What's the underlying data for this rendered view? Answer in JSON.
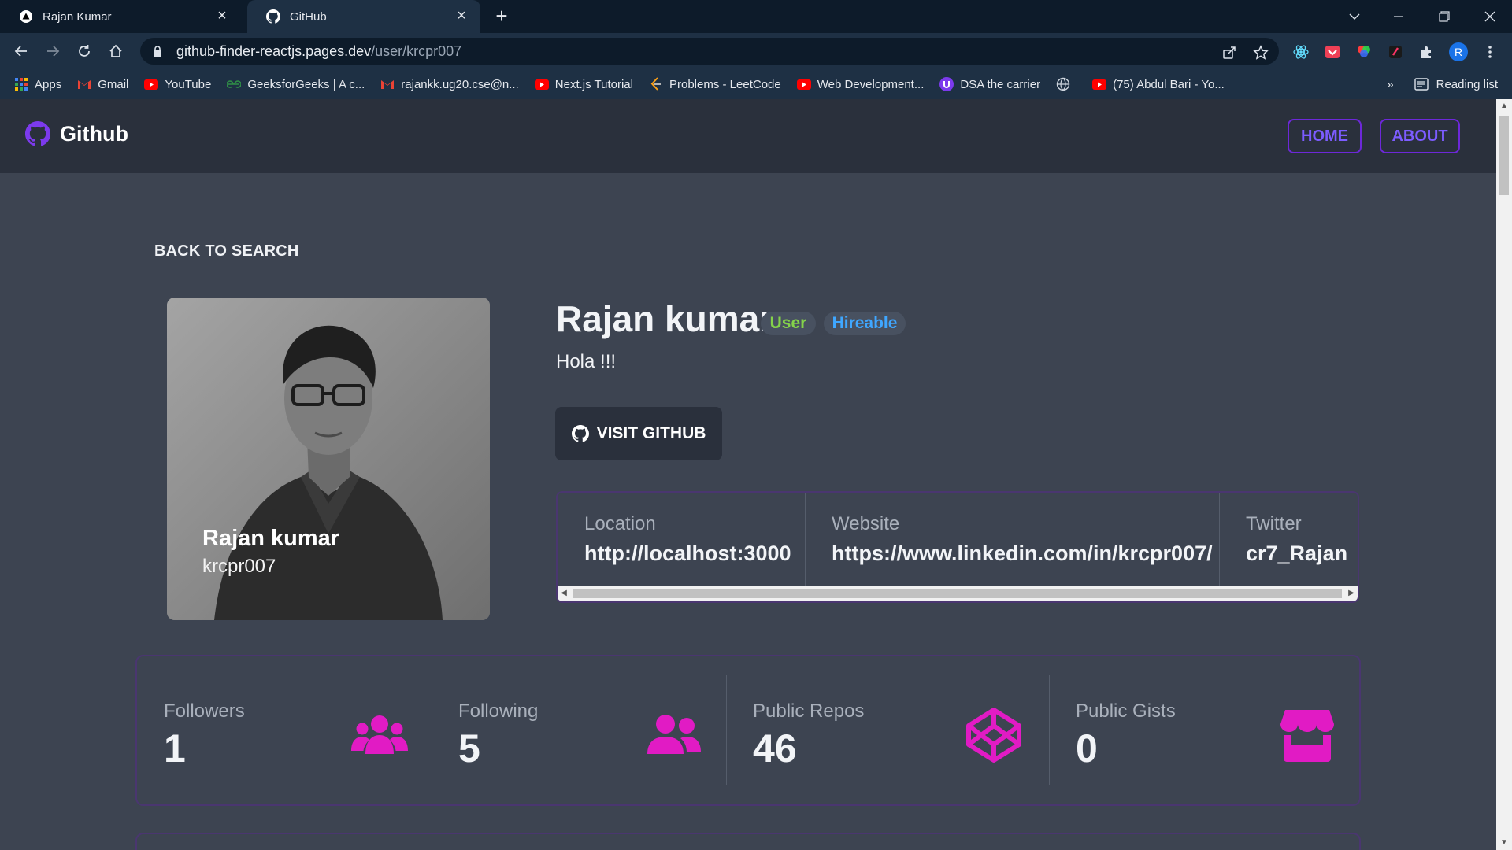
{
  "browser": {
    "tabs": [
      {
        "title": "Rajan Kumar",
        "active": false
      },
      {
        "title": "GitHub",
        "active": true
      }
    ],
    "url_host": "github-finder-reactjs.pages.dev",
    "url_path": "/user/krcpr007",
    "bookmarks": [
      {
        "label": "Apps",
        "icon": "apps-grid-icon"
      },
      {
        "label": "Gmail",
        "icon": "gmail-icon"
      },
      {
        "label": "YouTube",
        "icon": "youtube-icon"
      },
      {
        "label": "GeeksforGeeks | A c...",
        "icon": "gfg-icon"
      },
      {
        "label": "rajankk.ug20.cse@n...",
        "icon": "gmail-icon"
      },
      {
        "label": "Next.js Tutorial",
        "icon": "youtube-icon"
      },
      {
        "label": "Problems - LeetCode",
        "icon": "leetcode-icon"
      },
      {
        "label": "Web Development...",
        "icon": "youtube-icon"
      },
      {
        "label": "DSA the carrier",
        "icon": "purple-u-icon"
      },
      {
        "label": "",
        "icon": "globe-icon"
      },
      {
        "label": "(75) Abdul Bari - Yo...",
        "icon": "youtube-icon"
      }
    ],
    "more_bookmarks": "»",
    "reading_list": "Reading list",
    "profile_initial": "R"
  },
  "navbar": {
    "brand": "Github",
    "links": [
      "HOME",
      "ABOUT"
    ]
  },
  "profile": {
    "back_label": "BACK TO SEARCH",
    "name": "Rajan kumar",
    "login": "krcpr007",
    "type_badge": "User",
    "hireable_badge": "Hireable",
    "bio": "Hola !!!",
    "visit_label": "VISIT GITHUB",
    "info": [
      {
        "label": "Location",
        "value": "http://localhost:3000"
      },
      {
        "label": "Website",
        "value": "https://www.linkedin.com/in/krcpr007/"
      },
      {
        "label": "Twitter",
        "value": "cr7_Rajan"
      }
    ]
  },
  "stats": [
    {
      "label": "Followers",
      "value": "1",
      "icon": "users-icon"
    },
    {
      "label": "Following",
      "value": "5",
      "icon": "user-friends-icon"
    },
    {
      "label": "Public Repos",
      "value": "46",
      "icon": "codepen-icon"
    },
    {
      "label": "Public Gists",
      "value": "0",
      "icon": "store-icon"
    }
  ],
  "colors": {
    "page_bg": "#3d4451",
    "navbar_bg": "#2a303c",
    "accent_purple": "#6d28d9",
    "stat_icon_pink": "#e11bc4",
    "badge_green": "#84d24a",
    "badge_blue": "#3fa7ff"
  }
}
